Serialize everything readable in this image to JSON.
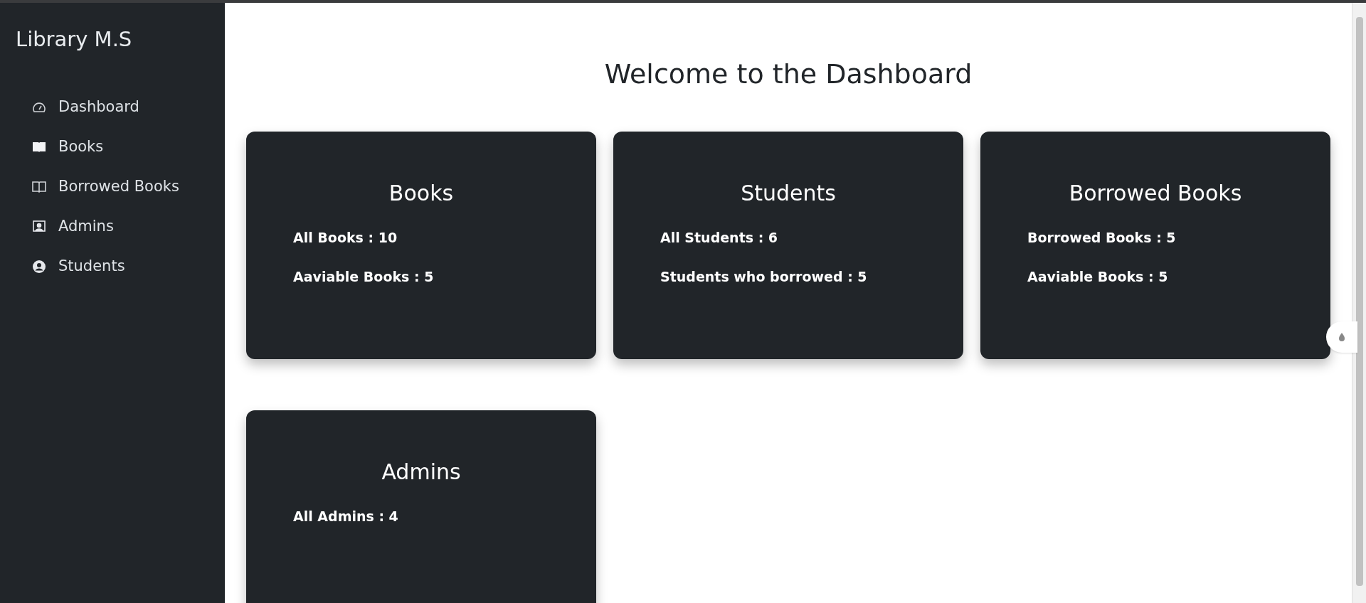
{
  "sidebar": {
    "brand": "Library M.S",
    "items": [
      {
        "label": "Dashboard"
      },
      {
        "label": "Books"
      },
      {
        "label": "Borrowed Books"
      },
      {
        "label": "Admins"
      },
      {
        "label": "Students"
      }
    ]
  },
  "heading": "Welcome to the Dashboard",
  "cards": [
    {
      "title": "Books",
      "stats": [
        "All Books : 10",
        "Aaviable Books : 5"
      ]
    },
    {
      "title": "Students",
      "stats": [
        "All Students : 6",
        "Students who borrowed : 5"
      ]
    },
    {
      "title": "Borrowed Books",
      "stats": [
        "Borrowed Books : 5",
        "Aaviable Books : 5"
      ]
    },
    {
      "title": "Admins",
      "stats": [
        "All Admins : 4"
      ]
    }
  ]
}
